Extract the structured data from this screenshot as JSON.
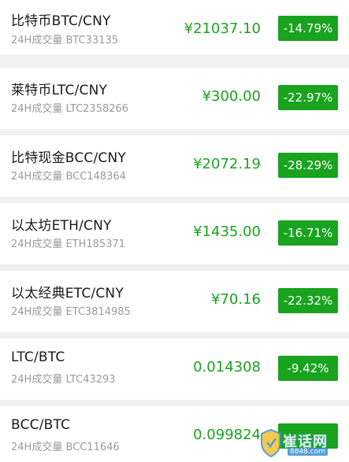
{
  "accent_green": "#1aa31e",
  "rows": [
    {
      "pair": "比特币BTC/CNY",
      "volume": "24H成交量 BTC33135",
      "price": "¥21037.10",
      "change": "-14.79%"
    },
    {
      "pair": "莱特币LTC/CNY",
      "volume": "24H成交量 LTC2358266",
      "price": "¥300.00",
      "change": "-22.97%"
    },
    {
      "pair": "比特现金BCC/CNY",
      "volume": "24H成交量 BCC148364",
      "price": "¥2072.19",
      "change": "-28.29%"
    },
    {
      "pair": "以太坊ETH/CNY",
      "volume": "24H成交量 ETH185371",
      "price": "¥1435.00",
      "change": "-16.71%"
    },
    {
      "pair": "以太经典ETC/CNY",
      "volume": "24H成交量 ETC3814985",
      "price": "¥70.16",
      "change": "-22.32%"
    },
    {
      "pair": "LTC/BTC",
      "volume": "24H成交量 LTC43293",
      "price": "0.014308",
      "change": "-9.42%"
    },
    {
      "pair": "BCC/BTC",
      "volume": "24H成交量 BCC11646",
      "price": "0.099824",
      "change": ""
    }
  ],
  "watermark": {
    "main": "崔话网",
    "sub": "8848.com"
  }
}
